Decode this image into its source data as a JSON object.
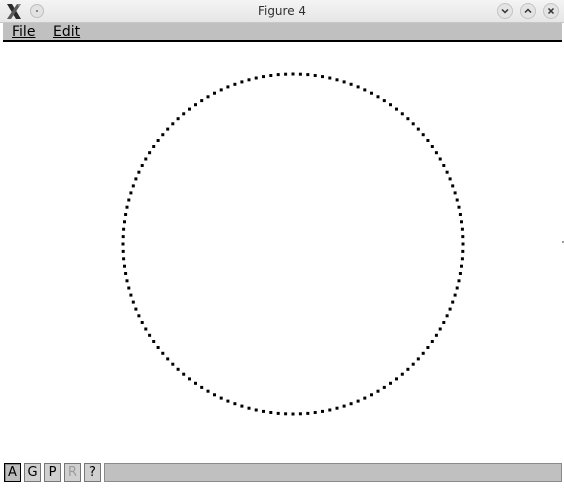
{
  "window": {
    "title": "Figure 4"
  },
  "menu": {
    "file_label": "File",
    "edit_label": "Edit"
  },
  "toolbar": {
    "buttons": [
      {
        "label": "A",
        "state": "active"
      },
      {
        "label": "G",
        "state": "normal"
      },
      {
        "label": "P",
        "state": "normal"
      },
      {
        "label": "R",
        "state": "disabled"
      },
      {
        "label": "?",
        "state": "normal"
      }
    ],
    "status_text": ""
  },
  "figure": {
    "shape": "circle",
    "stroke_color": "#000000",
    "marker": "square-dots",
    "point_count": 144
  },
  "colors": {
    "menubar_bg": "#c0c0c0",
    "titlebar_bg": "#ececec",
    "canvas_bg": "#ffffff"
  }
}
